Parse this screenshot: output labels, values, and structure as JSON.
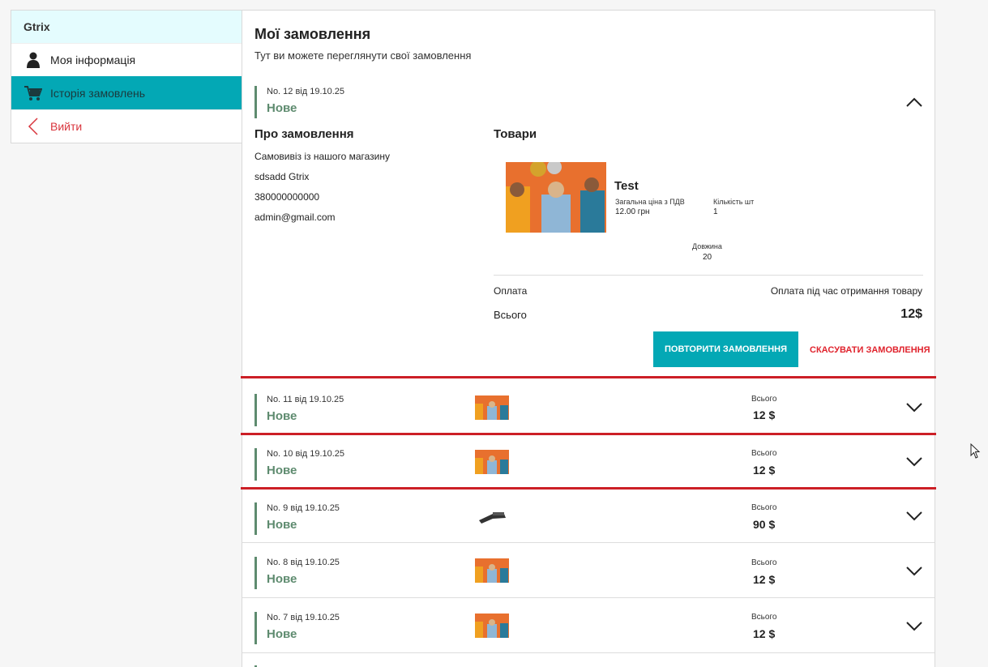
{
  "sidebar": {
    "brand": "Gtrix",
    "items": [
      {
        "label": "Моя інформація",
        "icon": "user-icon"
      },
      {
        "label": "Історія замовлень",
        "icon": "cart-icon"
      },
      {
        "label": "Вийти",
        "icon": "chevron-left-icon"
      }
    ]
  },
  "main": {
    "title": "Мої замовлення",
    "subtitle": "Тут ви можете переглянути свої замовлення",
    "expanded_order": {
      "number": "No. 12 від 19.10.25",
      "status": "Нове",
      "about_heading": "Про замовлення",
      "delivery": "Самовивіз із нашого магазину",
      "name": "sdsadd Gtrix",
      "phone": "380000000000",
      "email": "admin@gmail.com",
      "goods_heading": "Товари",
      "product": {
        "name": "Test",
        "price_label": "Загальна ціна з ПДВ",
        "price_value": "12.00 грн",
        "qty_label": "Кількість шт",
        "qty_value": "1",
        "length_label": "Довжина",
        "length_value": "20"
      },
      "payment_label": "Оплата",
      "payment_value": "Оплата під час отримання товару",
      "total_label": "Всього",
      "total_value": "12$",
      "repeat_button": "ПОВТОРИТИ ЗАМОВЛЕННЯ",
      "cancel_button": "СКАСУВАТИ ЗАМОВЛЕННЯ"
    },
    "orders": [
      {
        "number": "No. 11 від 19.10.25",
        "status": "Нове",
        "total_label": "Всього",
        "total": "12 $",
        "thumb": "party-photo"
      },
      {
        "number": "No. 10 від 19.10.25",
        "status": "Нове",
        "total_label": "Всього",
        "total": "12 $",
        "thumb": "party-photo"
      },
      {
        "number": "No. 9 від 19.10.25",
        "status": "Нове",
        "total_label": "Всього",
        "total": "90 $",
        "thumb": "tool-photo"
      },
      {
        "number": "No. 8 від 19.10.25",
        "status": "Нове",
        "total_label": "Всього",
        "total": "12 $",
        "thumb": "party-photo"
      },
      {
        "number": "No. 7 від 19.10.25",
        "status": "Нове",
        "total_label": "Всього",
        "total": "12 $",
        "thumb": "party-photo"
      }
    ]
  },
  "colors": {
    "accent": "#03a8b5",
    "status_green": "#5e8b6f",
    "danger": "#e0232d",
    "brand_bg": "#e4fcfe",
    "annotation_red": "#cc1f26"
  }
}
